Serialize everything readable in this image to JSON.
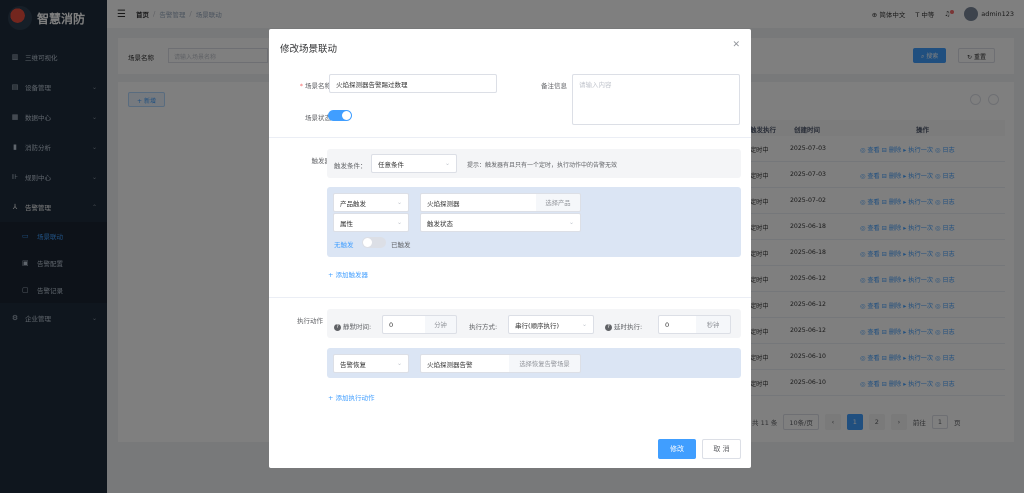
{
  "app": {
    "name": "智慧消防"
  },
  "sidebar": {
    "items": [
      {
        "label": "三维可视化",
        "icon": "chart-icon"
      },
      {
        "label": "设备管理",
        "icon": "device-icon"
      },
      {
        "label": "数据中心",
        "icon": "data-icon"
      },
      {
        "label": "消防分析",
        "icon": "analysis-icon"
      },
      {
        "label": "规则中心",
        "icon": "rule-icon"
      },
      {
        "label": "告警管理",
        "icon": "alarm-icon"
      }
    ],
    "sub_items": [
      {
        "label": "场景联动",
        "active": true
      },
      {
        "label": "告警配置",
        "active": false
      },
      {
        "label": "告警记录",
        "active": false
      }
    ],
    "bottom_item": {
      "label": "企业管理",
      "icon": "gear-icon"
    }
  },
  "header": {
    "breadcrumb": [
      "首页",
      "告警管理",
      "场景联动"
    ],
    "lang": "简体中文",
    "font_size": "中等",
    "user": "admin123"
  },
  "bg": {
    "search_label": "场景名称",
    "search_placeholder": "请输入场景名称",
    "search_btn": "搜索",
    "reset_btn": "重置",
    "add_btn": "新增",
    "table_headers": [
      "触发执行",
      "创建时间",
      "操作"
    ],
    "rows": [
      {
        "trigger": "定时中",
        "date": "2025-07-03"
      },
      {
        "trigger": "定时中",
        "date": "2025-07-03"
      },
      {
        "trigger": "定时中",
        "date": "2025-07-02"
      },
      {
        "trigger": "定时中",
        "date": "2025-06-18"
      },
      {
        "trigger": "定时中",
        "date": "2025-06-18"
      },
      {
        "trigger": "定时中",
        "date": "2025-06-12"
      },
      {
        "trigger": "定时中",
        "date": "2025-06-12"
      },
      {
        "trigger": "定时中",
        "date": "2025-06-12"
      },
      {
        "trigger": "定时中",
        "date": "2025-06-10"
      },
      {
        "trigger": "定时中",
        "date": "2025-06-10"
      }
    ],
    "row_ops": "◎ 查看  ⊟ 删除  ▸ 执行一次  ◎ 日志",
    "pager": {
      "total": "共 11 条",
      "per_page": "10条/页",
      "pages": [
        "1",
        "2"
      ],
      "goto_label": "前往",
      "goto_value": "1",
      "goto_suffix": "页"
    }
  },
  "modal": {
    "title": "修改场景联动",
    "scene_name_label": "场景名称",
    "scene_name_value": "火焰探测器告警踢过数理",
    "remark_label": "备注信息",
    "remark_placeholder": "请输入内容",
    "status_label": "场景状态",
    "trigger_label": "触发器",
    "condition_label": "触发条件：",
    "condition_value": "任意条件",
    "hint": "提示：触发器有且只有一个定时，执行动作中的告警无效",
    "trigger_type": "产品触发",
    "product_value": "火焰探测器",
    "select_product": "选择产品",
    "attr_type": "属性",
    "attr_value": "触发状态",
    "toggle_left": "无触发",
    "toggle_right": "已触发",
    "add_trigger": "+ 添加触发器",
    "action_label": "执行动作",
    "silence_label": "静默时间:",
    "silence_value": "0",
    "silence_unit": "分钟",
    "exec_mode_label": "执行方式:",
    "exec_mode_value": "串行(顺序执行)",
    "delay_label": "延时执行:",
    "delay_value": "0",
    "delay_unit": "秒钟",
    "action_type": "告警恢复",
    "alarm_value": "火焰探测器告警",
    "select_alarm": "选择恢复告警场景",
    "add_action": "+ 添加执行动作",
    "ok": "修改",
    "cancel": "取 消"
  },
  "colors": {
    "primary": "#409eff",
    "sidebar": "#1f2d3d"
  }
}
